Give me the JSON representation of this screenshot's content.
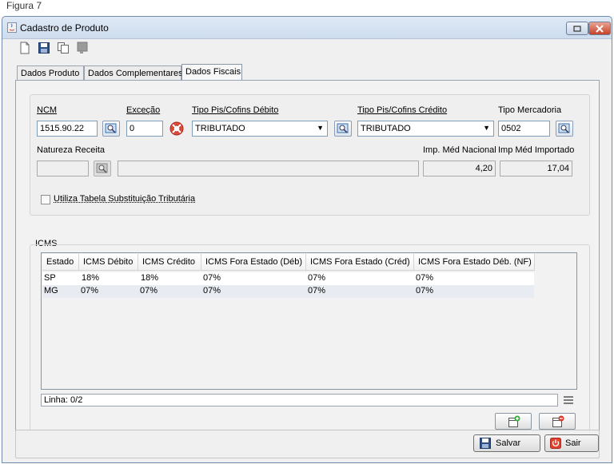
{
  "caption": "Figura 7",
  "window": {
    "title": "Cadastro de Produto"
  },
  "toolbar": {
    "icons": [
      "new-document-icon",
      "save-icon",
      "copy-icon",
      "delete-icon"
    ]
  },
  "tabs": [
    {
      "label": "Dados Produto",
      "active": false
    },
    {
      "label": "Dados Complementares",
      "active": false
    },
    {
      "label": "Dados Fiscais",
      "active": true
    }
  ],
  "fiscal": {
    "ncm_label": "NCM",
    "ncm_value": "1515.90.22",
    "excecao_label": "Exceção",
    "excecao_value": "0",
    "pis_debito_label": "Tipo Pis/Cofins Débito",
    "pis_debito_value": "TRIBUTADO",
    "pis_credito_label": "Tipo Pis/Cofins Crédito",
    "pis_credito_value": "TRIBUTADO",
    "tipo_mercadoria_label": "Tipo Mercadoria",
    "tipo_mercadoria_value": "0502",
    "natureza_label": "Natureza Receita",
    "natureza_code": "",
    "natureza_desc": "",
    "imp_nacional_label": "Imp. Méd Nacional",
    "imp_nacional_value": "4,20",
    "imp_importado_label": "Imp Méd Importado",
    "imp_importado_value": "17,04",
    "subst_checkbox_label": "Utiliza Tabela Substituição Tributária",
    "subst_checked": false
  },
  "icms": {
    "group_label": "ICMS",
    "columns": [
      "Estado",
      "ICMS Débito",
      "ICMS Crédito",
      "ICMS Fora Estado (Déb)",
      "ICMS Fora Estado (Créd)",
      "ICMS Fora Estado Déb. (NF)"
    ],
    "rows": [
      [
        "SP",
        "18%",
        "18%",
        "07%",
        "07%",
        "07%"
      ],
      [
        "MG",
        "07%",
        "07%",
        "07%",
        "07%",
        "07%"
      ]
    ],
    "status": "Linha: 0/2"
  },
  "actions": {
    "save_label": "Salvar",
    "exit_label": "Sair"
  },
  "colors": {
    "accent": "#7f9db9",
    "close_button": "#c7422a",
    "row_alt": "#e8ecf2"
  }
}
